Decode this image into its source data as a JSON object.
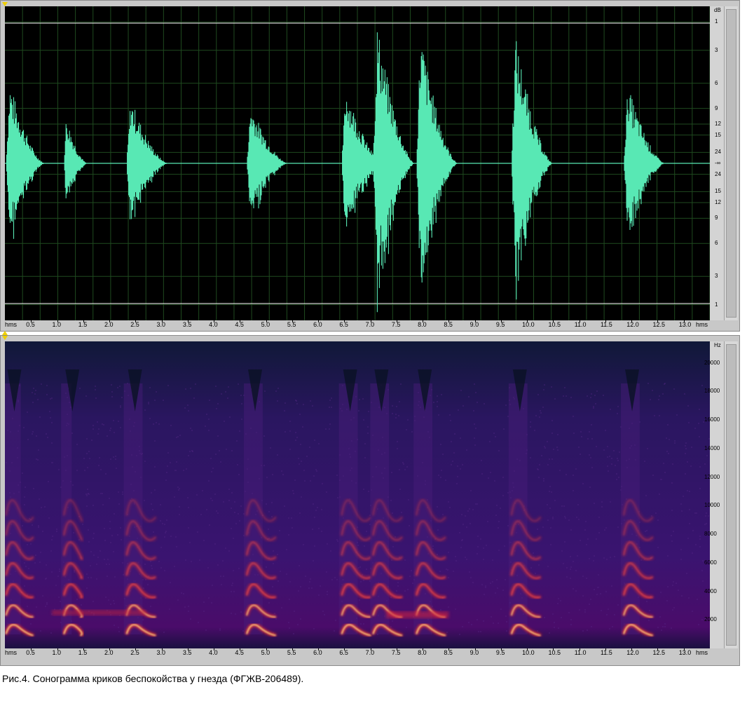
{
  "caption": "Рис.4. Сонограмма криков беспокойства у гнезда (ФГЖВ-206489).",
  "time_axis": {
    "unit": "hms",
    "ticks": [
      "0.5",
      "1.0",
      "1.5",
      "2.0",
      "2.5",
      "3.0",
      "3.5",
      "4.0",
      "4.5",
      "5.0",
      "5.5",
      "6.0",
      "6.5",
      "7.0",
      "7.5",
      "8.0",
      "8.5",
      "9.0",
      "9.5",
      "10.0",
      "10.5",
      "11.0",
      "11.5",
      "12.0",
      "12.5",
      "13.0"
    ],
    "max_seconds": 13.5
  },
  "waveform": {
    "unit": "dB",
    "level_labels": [
      "1",
      "3",
      "6",
      "9",
      "12",
      "15",
      "24",
      "-∞",
      "24",
      "15",
      "12",
      "9",
      "6",
      "3",
      "1"
    ],
    "color": "#58e8b4",
    "calls": [
      {
        "t": 0.02,
        "dur": 0.75,
        "amp": 0.26
      },
      {
        "t": 1.13,
        "dur": 0.45,
        "amp": 0.15
      },
      {
        "t": 2.33,
        "dur": 0.8,
        "amp": 0.21
      },
      {
        "t": 4.63,
        "dur": 0.8,
        "amp": 0.19
      },
      {
        "t": 6.45,
        "dur": 0.8,
        "amp": 0.25
      },
      {
        "t": 7.05,
        "dur": 0.8,
        "amp": 0.45
      },
      {
        "t": 7.88,
        "dur": 0.8,
        "amp": 0.42
      },
      {
        "t": 9.7,
        "dur": 0.8,
        "amp": 0.41
      },
      {
        "t": 11.85,
        "dur": 0.8,
        "amp": 0.25
      }
    ]
  },
  "spectrogram": {
    "unit": "Hz",
    "freq_labels": [
      "20000",
      "18000",
      "16000",
      "14000",
      "12000",
      "10000",
      "8000",
      "6000",
      "4000",
      "2000"
    ],
    "max_hz": 21500,
    "harmonic_hz": [
      1300,
      2600,
      4000,
      5400,
      6800,
      8200,
      9600
    ],
    "colors": {
      "background": "#2a1258",
      "harmonic": "#ff3020",
      "core": "#ffe890"
    }
  }
}
